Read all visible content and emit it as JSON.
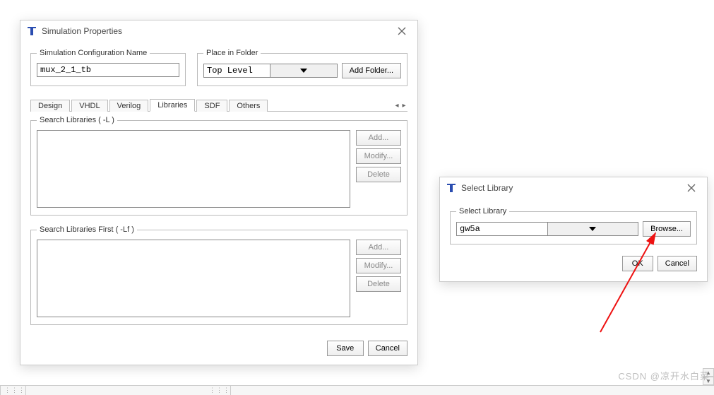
{
  "main": {
    "title": "Simulation Properties",
    "configName": {
      "legend": "Simulation Configuration Name",
      "value": "mux_2_1_tb"
    },
    "placeInFolder": {
      "legend": "Place in Folder",
      "value": "Top Level",
      "addFolder": "Add Folder..."
    },
    "tabs": [
      "Design",
      "VHDL",
      "Verilog",
      "Libraries",
      "SDF",
      "Others"
    ],
    "activeTab": "Libraries",
    "searchLibs": {
      "legend": "Search Libraries ( -L )",
      "buttons": {
        "add": "Add...",
        "modify": "Modify...",
        "delete": "Delete"
      }
    },
    "searchLibsFirst": {
      "legend": "Search Libraries First ( -Lf )",
      "buttons": {
        "add": "Add...",
        "modify": "Modify...",
        "delete": "Delete"
      }
    },
    "footer": {
      "save": "Save",
      "cancel": "Cancel"
    }
  },
  "selectLib": {
    "title": "Select Library",
    "legend": "Select Library",
    "value": "gw5a",
    "browse": "Browse...",
    "ok": "OK",
    "cancel": "Cancel"
  },
  "watermark": "CSDN @凉开水白菜"
}
